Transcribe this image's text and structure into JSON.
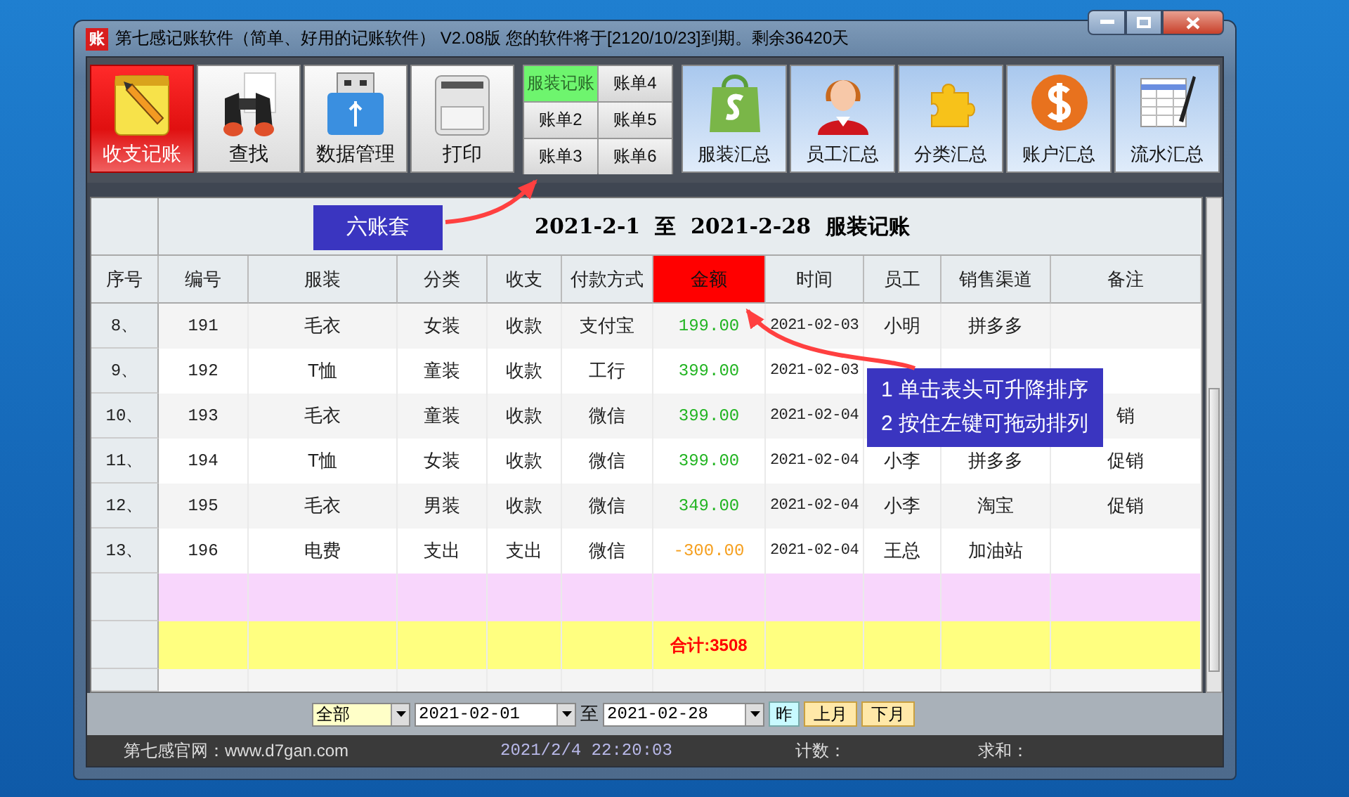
{
  "window": {
    "title": "第七感记账软件（简单、好用的记账软件） V2.08版 您的软件将于[2120/10/23]到期。剩余36420天",
    "app_icon": "账"
  },
  "toolbar": {
    "main_buttons": [
      {
        "label": "收支记账",
        "selected": true
      },
      {
        "label": "查找",
        "selected": false
      },
      {
        "label": "数据管理",
        "selected": false
      },
      {
        "label": "打印",
        "selected": false
      }
    ],
    "ledgers": [
      {
        "label": "服装记账",
        "selected": true
      },
      {
        "label": "账单4",
        "selected": false
      },
      {
        "label": "账单2",
        "selected": false
      },
      {
        "label": "账单5",
        "selected": false
      },
      {
        "label": "账单3",
        "selected": false
      },
      {
        "label": "账单6",
        "selected": false
      }
    ],
    "summary_buttons": [
      {
        "label": "服装汇总"
      },
      {
        "label": "员工汇总"
      },
      {
        "label": "分类汇总"
      },
      {
        "label": "账户汇总"
      },
      {
        "label": "流水汇总"
      }
    ]
  },
  "report_title": "2021-2-1  至  2021-2-28  服装记账",
  "table": {
    "columns": [
      {
        "label": "序号",
        "sorted": false
      },
      {
        "label": "编号",
        "sorted": false
      },
      {
        "label": "服装",
        "sorted": false
      },
      {
        "label": "分类",
        "sorted": false
      },
      {
        "label": "收支",
        "sorted": false
      },
      {
        "label": "付款方式",
        "sorted": false
      },
      {
        "label": "金额",
        "sorted": true
      },
      {
        "label": "时间",
        "sorted": false
      },
      {
        "label": "员工",
        "sorted": false
      },
      {
        "label": "销售渠道",
        "sorted": false
      },
      {
        "label": "备注",
        "sorted": false
      }
    ],
    "rows": [
      {
        "kind": "income",
        "cells": [
          "8、",
          "191",
          "毛衣",
          "女装",
          "收款",
          "支付宝",
          "199.00",
          "2021-02-03",
          "小明",
          "拼多多",
          ""
        ]
      },
      {
        "kind": "income",
        "cells": [
          "9、",
          "192",
          "T恤",
          "童装",
          "收款",
          "工行",
          "399.00",
          "2021-02-03",
          "",
          "",
          ""
        ]
      },
      {
        "kind": "income",
        "cells": [
          "10、",
          "193",
          "毛衣",
          "童装",
          "收款",
          "微信",
          "399.00",
          "2021-02-04",
          "",
          "",
          "销"
        ]
      },
      {
        "kind": "income",
        "cells": [
          "11、",
          "194",
          "T恤",
          "女装",
          "收款",
          "微信",
          "399.00",
          "2021-02-04",
          "小李",
          "拼多多",
          "促销"
        ]
      },
      {
        "kind": "income",
        "cells": [
          "12、",
          "195",
          "毛衣",
          "男装",
          "收款",
          "微信",
          "349.00",
          "2021-02-04",
          "小李",
          "淘宝",
          "促销"
        ]
      },
      {
        "kind": "expense",
        "cells": [
          "13、",
          "196",
          "电费",
          "支出",
          "支出",
          "微信",
          "-300.00",
          "2021-02-04",
          "王总",
          "加油站",
          ""
        ]
      }
    ],
    "total": "合计:3508"
  },
  "filter": {
    "category": "全部",
    "date_from": "2021-02-01",
    "to_label": "至",
    "date_to": "2021-02-28",
    "query_button": "昨",
    "month_buttons": [
      "上月",
      "下月"
    ]
  },
  "status_bar": {
    "website": "第七感官网：www.d7gan.com",
    "datetime": "2021/2/4 22:20:03",
    "count_label": "计数：",
    "sum_label": "求和："
  },
  "callouts": [
    {
      "lines": [
        "六账套"
      ]
    },
    {
      "lines": [
        "1 单击表头可升降排序",
        "2 按住左键可拖动排列"
      ]
    }
  ]
}
